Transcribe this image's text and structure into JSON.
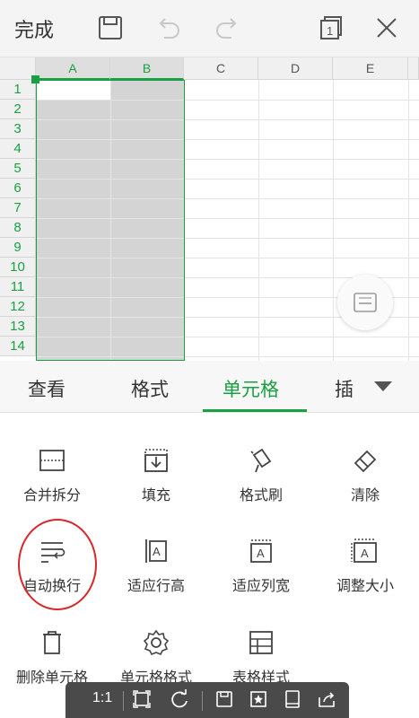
{
  "toolbar": {
    "done_label": "完成",
    "icons": [
      "save-icon",
      "undo-icon",
      "redo-icon",
      "sheet-count-icon",
      "close-icon"
    ],
    "sheet_count": "1"
  },
  "sheet": {
    "columns": [
      "A",
      "B",
      "C",
      "D",
      "E"
    ],
    "rows": [
      "1",
      "2",
      "3",
      "4",
      "5",
      "6",
      "7",
      "8",
      "9",
      "10",
      "11",
      "12",
      "13",
      "14"
    ],
    "selected_columns": [
      "A",
      "B"
    ],
    "active_cell": "A1"
  },
  "tabs": {
    "items": [
      "查看",
      "格式",
      "单元格",
      "插"
    ],
    "active": "单元格"
  },
  "tools": {
    "merge_split": "合并拆分",
    "fill": "填充",
    "format_painter": "格式刷",
    "clear": "清除",
    "auto_wrap": "自动换行",
    "fit_row_height": "适应行高",
    "fit_col_width": "适应列宽",
    "resize": "调整大小",
    "delete_cell": "删除单元格",
    "cell_format": "单元格格式",
    "table_style": "表格样式"
  },
  "bottombar": {
    "ratio": "1:1"
  },
  "colors": {
    "accent": "#1aa044",
    "annotation": "#d9262a"
  }
}
